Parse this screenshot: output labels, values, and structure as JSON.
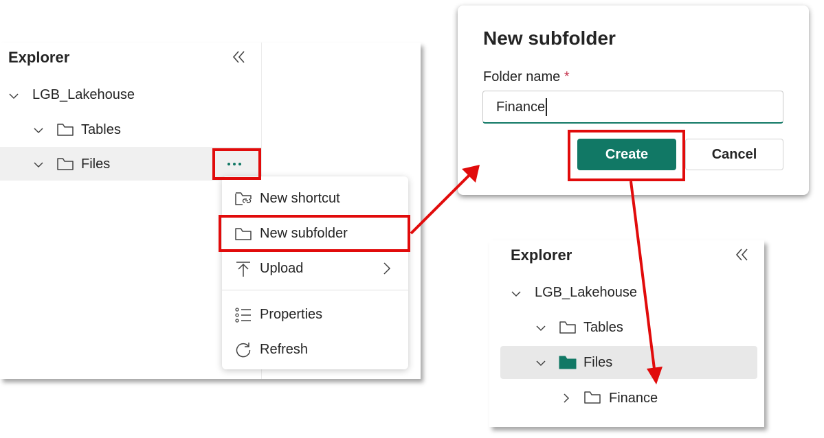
{
  "explorer_left": {
    "title": "Explorer",
    "tree": {
      "root": "LGB_Lakehouse",
      "tables": "Tables",
      "files": "Files"
    }
  },
  "context_menu": {
    "items": [
      {
        "label": "New shortcut",
        "icon": "shortcut-folder-icon"
      },
      {
        "label": "New subfolder",
        "icon": "folder-icon"
      },
      {
        "label": "Upload",
        "icon": "upload-icon"
      },
      {
        "label": "Properties",
        "icon": "properties-list-icon"
      },
      {
        "label": "Refresh",
        "icon": "refresh-icon"
      }
    ]
  },
  "dialog": {
    "title": "New subfolder",
    "field_label": "Folder name",
    "required_mark": "*",
    "field_value": "Finance",
    "create_label": "Create",
    "cancel_label": "Cancel"
  },
  "explorer_right": {
    "title": "Explorer",
    "tree": {
      "root": "LGB_Lakehouse",
      "tables": "Tables",
      "files": "Files",
      "new_folder": "Finance"
    }
  },
  "colors": {
    "accent": "#117865",
    "highlight": "#e10b0b",
    "selected_row": "#f0f0f0"
  }
}
